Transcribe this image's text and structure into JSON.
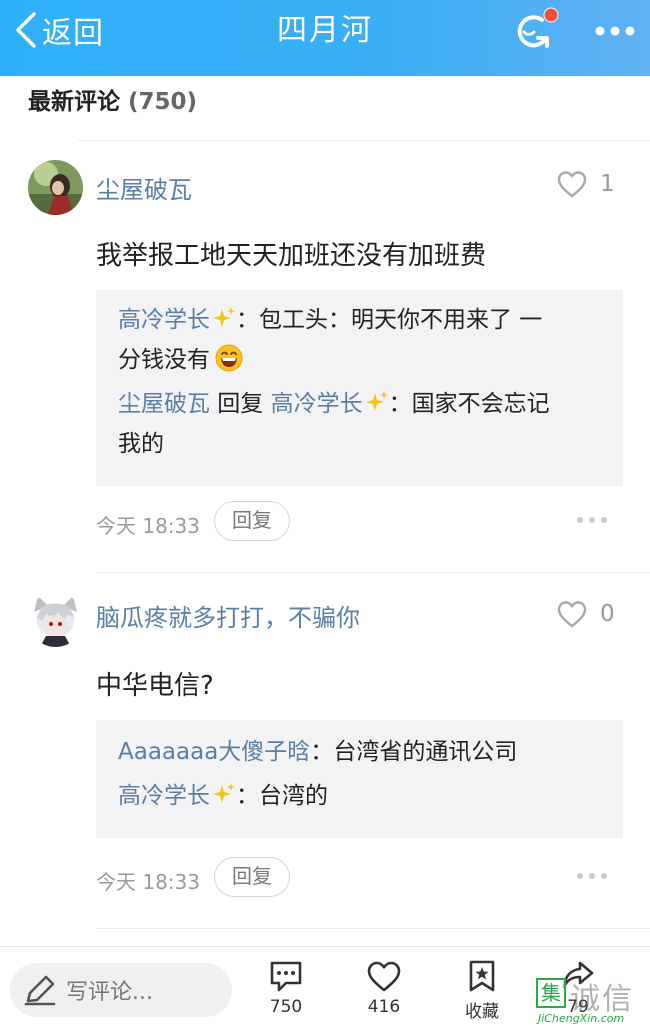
{
  "header": {
    "back_label": "返回",
    "title": "四月河"
  },
  "section": {
    "title": "最新评论",
    "count": "(750)"
  },
  "comments": [
    {
      "name": "尘屋破瓦",
      "likes": "1",
      "text": "我举报工地天天加班还没有加班费",
      "replies": [
        {
          "line1_name": "高冷学长",
          "line1_text": "：包工头：明天你不用来了 一",
          "line2_text": "分钱没有"
        },
        {
          "line1_name": "尘屋破瓦",
          "line1_mid": " 回复 ",
          "line1_name2": "高冷学长",
          "line1_text": "：国家不会忘记",
          "line2_text": "我的"
        }
      ],
      "time": "今天 18:33",
      "reply_label": "回复"
    },
    {
      "name": "脑瓜疼就多打打，不骗你",
      "likes": "0",
      "text": "中华电信?",
      "replies": [
        {
          "line1_name": "Aaaaaaa大傻子晗",
          "line1_text": "：台湾省的通讯公司"
        },
        {
          "line1_name": "高冷学长",
          "line1_text": "：台湾的"
        }
      ],
      "time": "今天 18:33",
      "reply_label": "回复"
    }
  ],
  "bottom": {
    "input_placeholder": "写评论...",
    "comment_count": "750",
    "like_count": "416",
    "favorite_label": "收藏",
    "share_count": "79"
  },
  "watermark": {
    "box": "集",
    "big": "诚信",
    "url": "JiChengXin.com"
  },
  "colors": {
    "header": "#2eb0f8",
    "name": "#5a7fa6",
    "badge": "#f0503a"
  }
}
